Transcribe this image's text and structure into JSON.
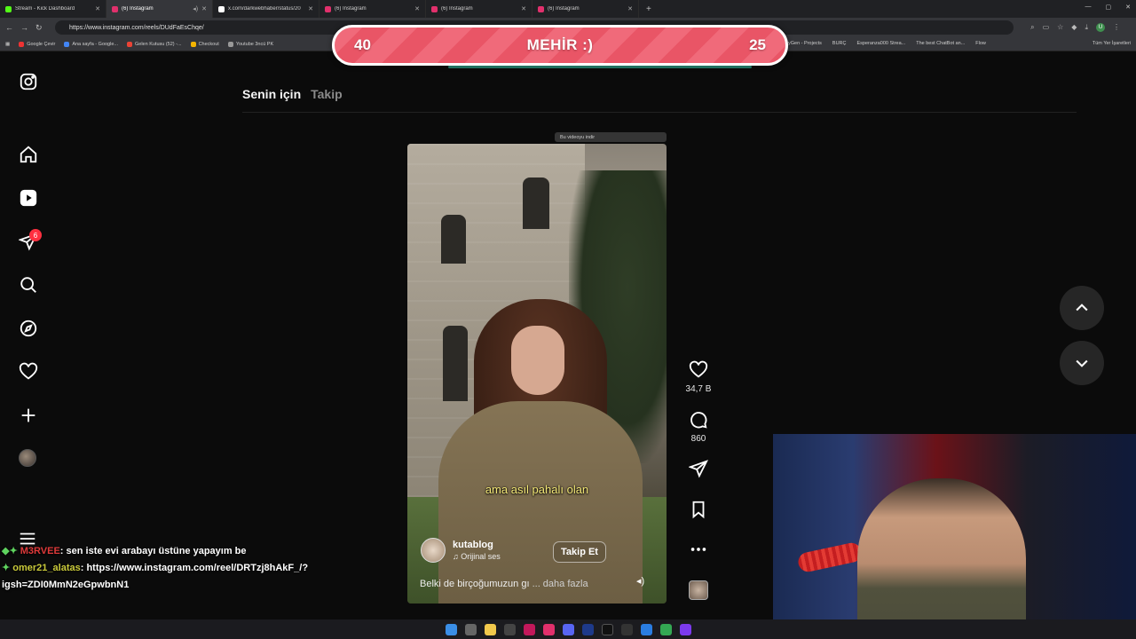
{
  "browser": {
    "tabs": [
      {
        "title": "Stream - Kick Dashboard",
        "color": "#53fc18"
      },
      {
        "title": "(6) Instagram",
        "color": "#e1306c"
      },
      {
        "title": "x.com/darkwebhaber/status/20",
        "color": "#ffffff"
      },
      {
        "title": "(6) Instagram",
        "color": "#e1306c"
      },
      {
        "title": "(6) Instagram",
        "color": "#e1306c"
      },
      {
        "title": "(6) Instagram",
        "color": "#e1306c"
      }
    ],
    "url": "https://www.instagram.com/reels/DUdFaEsChqe/",
    "bookmarks": [
      "Google Çevir",
      "Ana sayfa - Google...",
      "Gelen Kutusu (52) -...",
      "Checkout",
      "Youtube 3ncü PK"
    ],
    "bookmarks_right": [
      "yGen - Projects",
      "BURÇ",
      "Esperanza000 Strea...",
      "The best ChatBot an...",
      "Flow"
    ],
    "all_bookmarks": "Tüm Yer İşaretleri"
  },
  "poll": {
    "left_value": "40",
    "title": "MEHİR :)",
    "right_value": "25"
  },
  "sidebar": {
    "notification_count": "6"
  },
  "feed_tabs": {
    "for_you": "Senin için",
    "following": "Takip"
  },
  "reel": {
    "download_hint": "Bu videoyu indir",
    "caption": "ama asıl pahalı olan",
    "author": "kutablog",
    "audio": "Orijinal ses",
    "follow_label": "Takip Et",
    "description": "Belki de birçoğumuzun gı",
    "more_label": "... daha fazla",
    "likes": "34,7 B",
    "comments": "860"
  },
  "chat": [
    {
      "user": "M3RVEE",
      "message": ": sen iste evi arabayı üstüne yapayım be"
    },
    {
      "user": "omer21_alatas",
      "message": ": https://www.instagram.com/reel/DRTzj8hAkF_/?"
    },
    {
      "user": "",
      "message": "igsh=ZDI0MmN2eGpwbnN1"
    }
  ]
}
